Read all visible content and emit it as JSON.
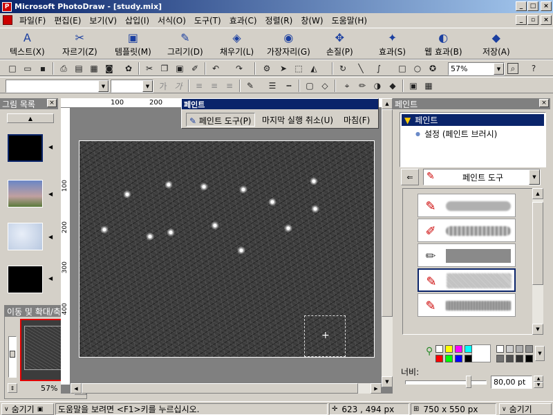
{
  "window": {
    "title": "Microsoft PhotoDraw - [study.mix]",
    "app_icon": "photodraw-icon"
  },
  "menu": [
    "파일(F)",
    "편집(E)",
    "보기(V)",
    "삽입(I)",
    "서식(O)",
    "도구(T)",
    "효과(C)",
    "정렬(R)",
    "창(W)",
    "도움말(H)"
  ],
  "big_toolbar": [
    {
      "label": "텍스트(X)",
      "icon": "A"
    },
    {
      "label": "자르기(Z)",
      "icon": "✂"
    },
    {
      "label": "템플릿(M)",
      "icon": "▣"
    },
    {
      "label": "그리기(D)",
      "icon": "✎"
    },
    {
      "label": "채우기(L)",
      "icon": "◈"
    },
    {
      "label": "가장자리(G)",
      "icon": "◉"
    },
    {
      "label": "손질(P)",
      "icon": "✥"
    },
    {
      "label": "효과(S)",
      "icon": "✦"
    },
    {
      "label": "웹 효과(B)",
      "icon": "◐"
    },
    {
      "label": "저장(A)",
      "icon": "◆"
    }
  ],
  "toolbar": {
    "zoom_value": "57%"
  },
  "left_panel": {
    "title": "그림 목록"
  },
  "navigator": {
    "title": "이동 및 확대/축소",
    "zoom": "57%"
  },
  "ruler": {
    "h_labels": [
      "100",
      "200"
    ],
    "v_labels": [
      "100",
      "200",
      "300",
      "400"
    ]
  },
  "paint_bar": {
    "title": "페인트",
    "tool_button": "페인트 도구(P)",
    "undo_button": "마지막 실행 취소(U)",
    "finish_button": "마침(F)"
  },
  "right_panel": {
    "title": "페인트",
    "tree_root": "페인트",
    "tree_child": "설정 (페인트 브러시)",
    "tool_select": "페인트 도구",
    "width_label": "너비:",
    "width_value": "80,00 pt"
  },
  "palette_colors": [
    "#ffffff",
    "#ffff00",
    "#ff00ff",
    "#00ffff",
    "#ff0000",
    "#00ff00",
    "#0000ff",
    "#000000"
  ],
  "gray_colors": [
    "#ffffff",
    "#d0d0d0",
    "#b0b0b0",
    "#909090",
    "#707070",
    "#505050",
    "#303030",
    "#000000"
  ],
  "status": {
    "hide_left": "숨기기",
    "help": "도움말을 보려면 <F1>키를 누르십시오.",
    "position": "623 , 494  px",
    "size": "750 x 550  px",
    "hide_right": "숨기기"
  }
}
